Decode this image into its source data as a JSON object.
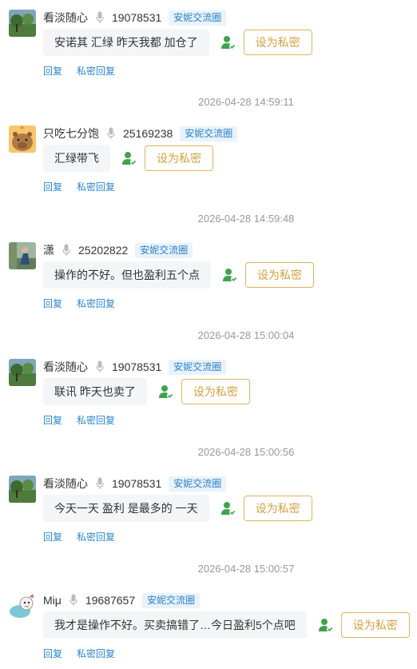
{
  "messages": [
    {
      "username": "看淡随心",
      "uid": "19078531",
      "group": "安妮交流圈",
      "text": "安诺其 汇绿 昨天我都 加仓了",
      "private_label": "设为私密",
      "reply_label": "回复",
      "private_reply_label": "私密回复",
      "avatar": "landscape-avatar"
    },
    {
      "username": "只吃七分饱",
      "uid": "25169238",
      "group": "安妮交流圈",
      "text": "汇绿带飞",
      "private_label": "设为私密",
      "reply_label": "回复",
      "private_reply_label": "私密回复",
      "avatar": "capybara-avatar"
    },
    {
      "username": "潇",
      "uid": "25202822",
      "group": "安妮交流圈",
      "text": "操作的不好。但也盈利五个点",
      "private_label": "设为私密",
      "reply_label": "回复",
      "private_reply_label": "私密回复",
      "avatar": "figure-avatar"
    },
    {
      "username": "看淡随心",
      "uid": "19078531",
      "group": "安妮交流圈",
      "text": "联讯 昨天也卖了",
      "private_label": "设为私密",
      "reply_label": "回复",
      "private_reply_label": "私密回复",
      "avatar": "landscape-avatar"
    },
    {
      "username": "看淡随心",
      "uid": "19078531",
      "group": "安妮交流圈",
      "text": "今天一天 盈利 是最多的 一天",
      "private_label": "设为私密",
      "reply_label": "回复",
      "private_reply_label": "私密回复",
      "avatar": "landscape-avatar"
    },
    {
      "username": "Miμ",
      "uid": "19687657",
      "group": "安妮交流圈",
      "text": "我才是操作不好。买卖搞错了…今日盈利5个点吧",
      "private_label": "设为私密",
      "reply_label": "回复",
      "private_reply_label": "私密回复",
      "avatar": "cartoon-avatar"
    }
  ],
  "timestamps": [
    "2026-04-28 14:59:11",
    "2026-04-28 14:59:48",
    "2026-04-28 15:00:04",
    "2026-04-28 15:00:56",
    "2026-04-28 15:00:57"
  ],
  "icons": {
    "mic": "microphone-icon",
    "person": "person-check-icon"
  },
  "colors": {
    "group_tag_bg": "#e8f3fc",
    "group_tag_text": "#2b7fc7",
    "link": "#2b86cf",
    "private_button": "#d4a13f",
    "person_icon": "#3fa34d",
    "timestamp": "#999999"
  }
}
